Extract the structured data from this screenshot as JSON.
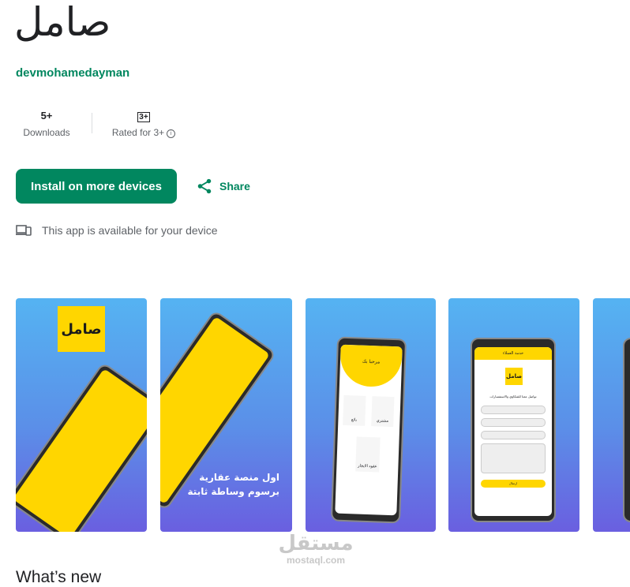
{
  "app": {
    "title": "صامل",
    "developer": "devmohamedayman"
  },
  "stats": {
    "downloads_value": "5+",
    "downloads_label": "Downloads",
    "rating_badge": "3+",
    "rating_label": "Rated for 3+"
  },
  "actions": {
    "install_label": "Install on more devices",
    "share_label": "Share"
  },
  "device_note": "This app is available for your device",
  "screenshots": {
    "logo_text": "صامل",
    "tagline_line1": "اول منصة عقارية",
    "tagline_line2": "برسوم وساطة ثابتة",
    "s3_header": "مرحبا بك",
    "s3_card1": "بائع",
    "s3_card2": "مشتري",
    "s3_card3": "عقود الايجار",
    "s4_header": "خدمة العملاء",
    "s4_subtitle": "تواصل معنا للشكاوي والاستفسارات",
    "s4_send": "ارسال"
  },
  "watermark": {
    "arabic": "مستقل",
    "latin": "mostaql.com"
  },
  "section_title": "What’s new",
  "colors": {
    "accent": "#01875f",
    "brand_yellow": "#ffd600"
  }
}
